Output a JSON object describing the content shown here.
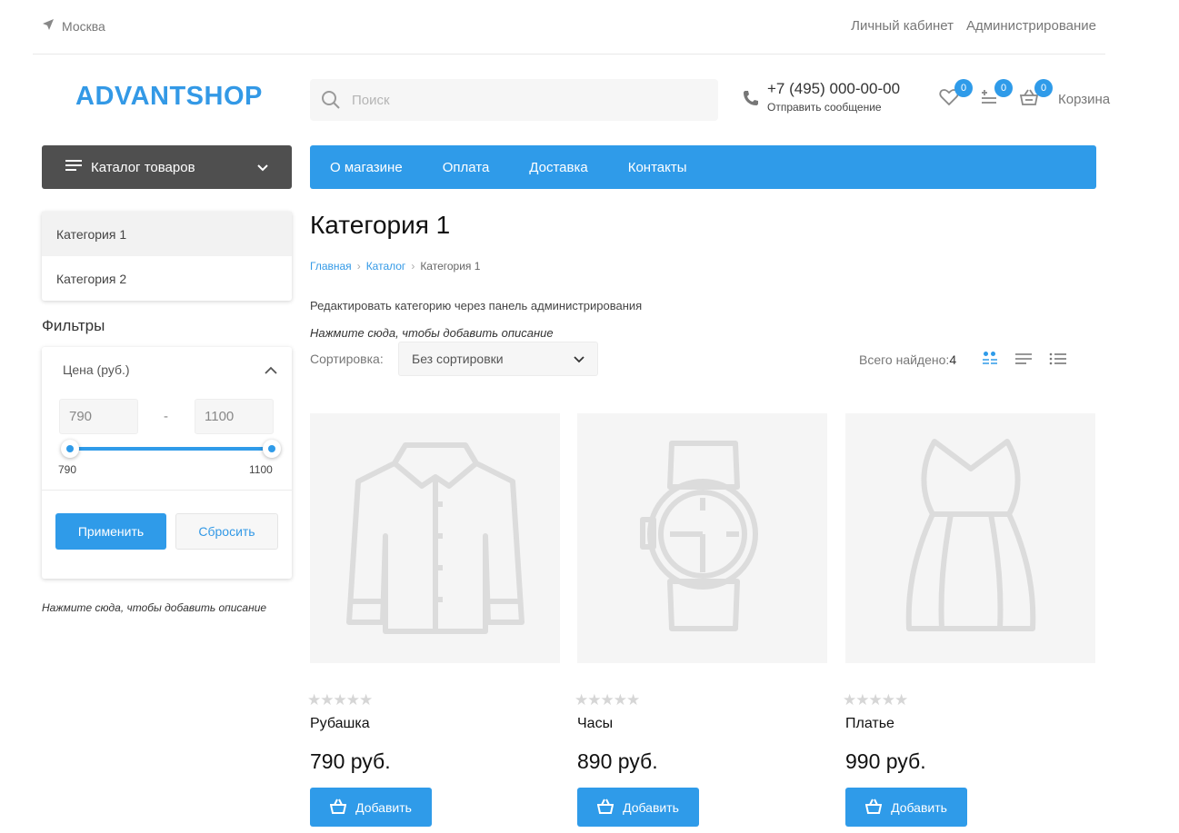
{
  "topbar": {
    "city": "Москва",
    "links": [
      "Личный кабинет",
      "Администрирование"
    ]
  },
  "header": {
    "logo": "ADVANTSHOP",
    "search_placeholder": "Поиск",
    "phone": "+7 (495) 000-00-00",
    "send_message": "Отправить сообщение",
    "wishlist_count": "0",
    "compare_count": "0",
    "cart_count": "0",
    "cart_label": "Корзина"
  },
  "nav": {
    "catalog_label": "Каталог товаров",
    "items": [
      "О магазине",
      "Оплата",
      "Доставка",
      "Контакты"
    ]
  },
  "sidebar": {
    "categories": [
      {
        "label": "Категория 1"
      },
      {
        "label": "Категория 2"
      }
    ],
    "filters_title": "Фильтры",
    "price_filter": {
      "label": "Цена (руб.)",
      "min": "790",
      "max": "1100",
      "range_min_label": "790",
      "range_max_label": "1100",
      "dash": "-"
    },
    "apply_label": "Применить",
    "reset_label": "Сбросить",
    "description_hint": "Нажмите сюда, чтобы добавить описание"
  },
  "main": {
    "title": "Категория 1",
    "breadcrumb": [
      "Главная",
      "Каталог",
      "Категория 1"
    ],
    "edit_category": "Редактировать категорию через панель администрирования",
    "add_description": "Нажмите сюда, чтобы добавить описание",
    "sort_label": "Сортировка:",
    "sort_value": "Без сортировки",
    "found_label": "Всего найдено:",
    "found_count": "4"
  },
  "products": [
    {
      "name": "Рубашка",
      "price": "790 руб.",
      "rating": 0,
      "image": "shirt-icon",
      "button": "Добавить"
    },
    {
      "name": "Часы",
      "price": "890 руб.",
      "rating": 0,
      "image": "watch-icon",
      "button": "Добавить"
    },
    {
      "name": "Платье",
      "price": "990 руб.",
      "rating": 0,
      "image": "dress-icon",
      "button": "Добавить"
    }
  ],
  "colors": {
    "accent": "#2f9be9",
    "catalog_bg": "#4f4f4f",
    "image_bg": "#f5f5f5",
    "stars": "#d6d6d6"
  }
}
